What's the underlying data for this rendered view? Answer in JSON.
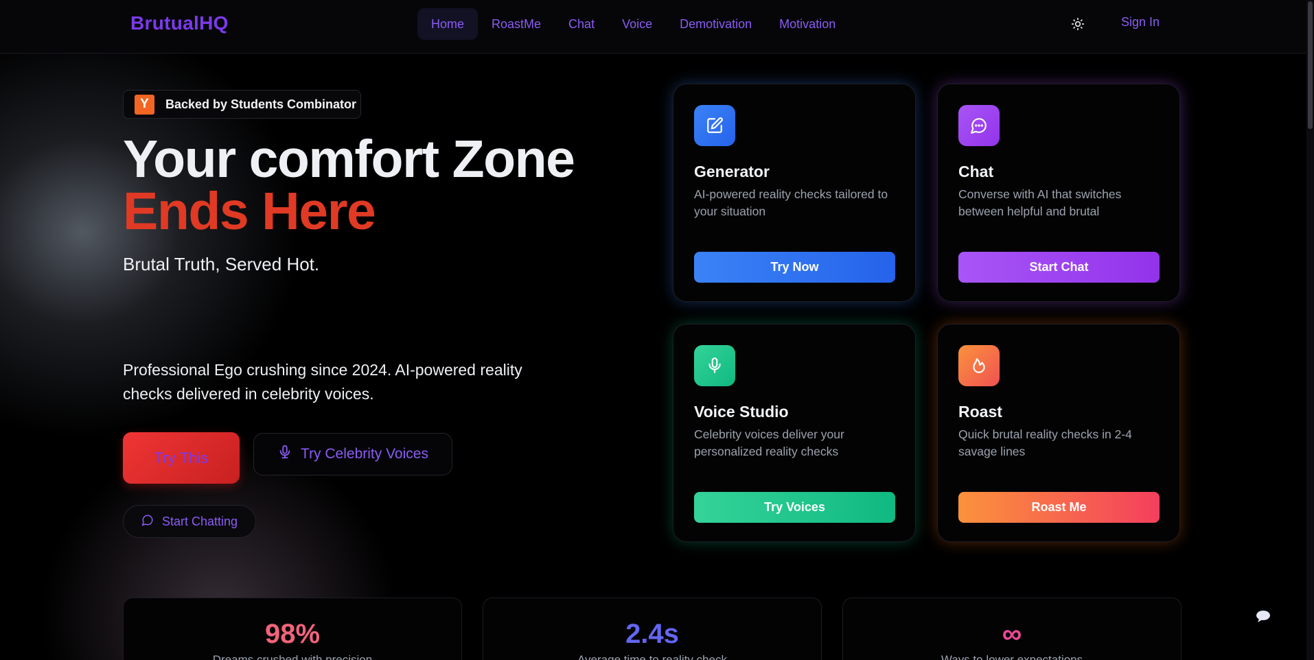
{
  "nav": {
    "logo": "BrutualHQ",
    "links": [
      {
        "label": "Home",
        "active": true
      },
      {
        "label": "RoastMe",
        "active": false
      },
      {
        "label": "Chat",
        "active": false
      },
      {
        "label": "Voice",
        "active": false
      },
      {
        "label": "Demotivation",
        "active": false
      },
      {
        "label": "Motivation",
        "active": false
      }
    ],
    "theme_icon": "sun-icon",
    "sign_in": "Sign In"
  },
  "hero": {
    "badge_letter": "Y",
    "badge_text": "Backed by Students Combinator",
    "headline_line1": "Your comfort Zone",
    "headline_line2": "Ends Here",
    "tagline": "Brutal Truth, Served Hot.",
    "description": "Professional Ego crushing since 2024. AI-powered reality checks delivered in celebrity voices.",
    "buttons": {
      "try_this": "Try This",
      "try_voices": "Try Celebrity Voices",
      "start_chatting": "Start Chatting"
    }
  },
  "cards": [
    {
      "title": "Generator",
      "description": "AI-powered reality checks tailored to your situation",
      "button": "Try Now",
      "icon": "edit-icon",
      "color": "#3b82f6"
    },
    {
      "title": "Chat",
      "description": "Converse with AI that switches between helpful and brutal",
      "button": "Start Chat",
      "icon": "chat-bubble-icon",
      "color": "#a855f7"
    },
    {
      "title": "Voice Studio",
      "description": "Celebrity voices deliver your personalized reality checks",
      "button": "Try Voices",
      "icon": "microphone-icon",
      "color": "#10b981"
    },
    {
      "title": "Roast",
      "description": "Quick brutal reality checks in 2-4 savage lines",
      "button": "Roast Me",
      "icon": "flame-icon",
      "color": "#f97316"
    }
  ],
  "stats": [
    {
      "value": "98%",
      "label": "Dreams crushed with precision",
      "color": "#f0647a"
    },
    {
      "value": "2.4s",
      "label": "Average time to reality check",
      "color": "#6366f1"
    },
    {
      "value": "∞",
      "label": "Ways to lower expectations",
      "color": "#ec4899"
    }
  ],
  "colors": {
    "brand": "#7c3aed",
    "accent_red": "#e03a24"
  }
}
